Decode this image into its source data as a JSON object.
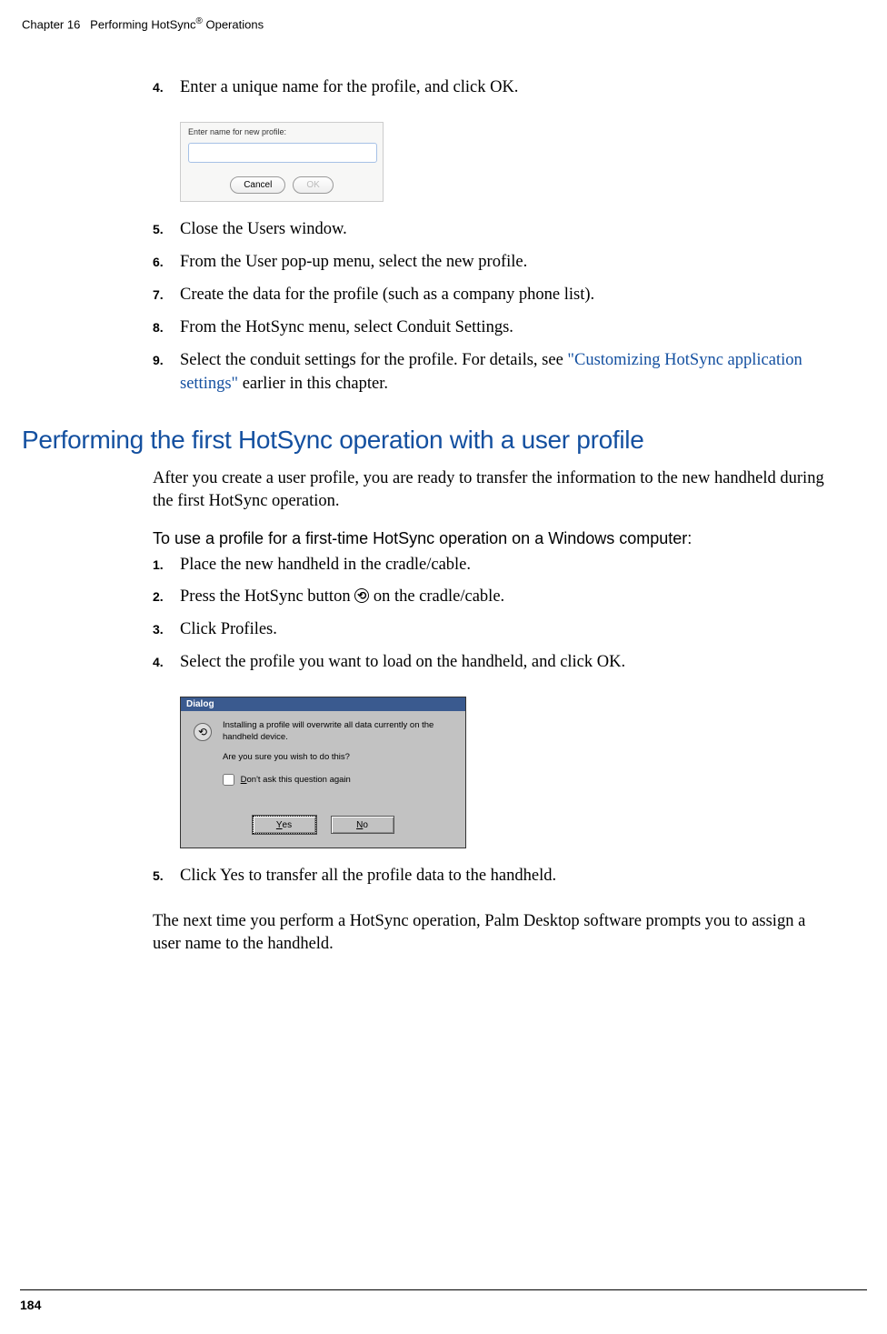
{
  "header": {
    "chapter": "Chapter 16",
    "title": "Performing HotSync",
    "reg": "®",
    "suffix": " Operations"
  },
  "steps_a": [
    {
      "num": "4.",
      "text": "Enter a unique name for the profile, and click OK."
    }
  ],
  "dialog1": {
    "label": "Enter name for new profile:",
    "cancel": "Cancel",
    "ok": "OK"
  },
  "steps_b": [
    {
      "num": "5.",
      "text": "Close the Users window."
    },
    {
      "num": "6.",
      "text": "From the User pop-up menu, select the new profile."
    },
    {
      "num": "7.",
      "text": "Create the data for the profile (such as a company phone list)."
    },
    {
      "num": "8.",
      "text": "From the HotSync menu, select Conduit Settings."
    },
    {
      "num": "9.",
      "prefix": "Select the conduit settings for the profile. For details, see ",
      "link": "\"Customizing HotSync application settings\"",
      "suffix": " earlier in this chapter."
    }
  ],
  "section_title": "Performing the first HotSync operation with a user profile",
  "section_intro": "After you create a user profile, you are ready to transfer the information to the new handheld during the first HotSync operation.",
  "sub_heading": "To use a profile for a first-time HotSync operation on a Windows computer:",
  "steps_c": [
    {
      "num": "1.",
      "text": "Place the new handheld in the cradle/cable."
    },
    {
      "num": "2.",
      "prefix": "Press the HotSync button  ",
      "suffix": " on the cradle/cable."
    },
    {
      "num": "3.",
      "text": "Click Profiles."
    },
    {
      "num": "4.",
      "text": "Select the profile you want to load on the handheld, and click OK."
    }
  ],
  "dialog2": {
    "title": "Dialog",
    "warning": "Installing a profile will overwrite all data currently on the handheld device.",
    "question": "Are you sure you wish to do this?",
    "checkbox_prefix_u": "D",
    "checkbox_rest": "on't ask this question again",
    "yes_u": "Y",
    "yes_rest": "es",
    "no_u": "N",
    "no_rest": "o"
  },
  "steps_d": [
    {
      "num": "5.",
      "text": "Click Yes to transfer all the profile data to the handheld."
    }
  ],
  "closing_para": "The next time you perform a HotSync operation, Palm Desktop software prompts you to assign a user name to the handheld.",
  "page_num": "184"
}
